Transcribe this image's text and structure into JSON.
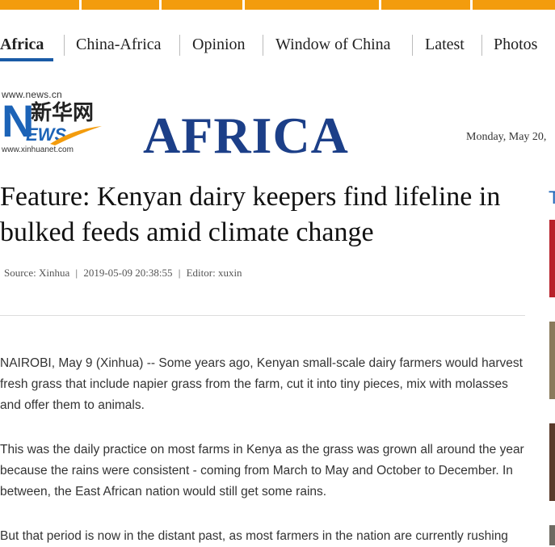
{
  "top_bar": {
    "color": "#f39c0d"
  },
  "nav": {
    "items": [
      {
        "label": "Africa",
        "active": true
      },
      {
        "label": "China-Africa"
      },
      {
        "label": "Opinion"
      },
      {
        "label": "Window of China"
      },
      {
        "label": "Latest"
      },
      {
        "label": "Photos"
      }
    ]
  },
  "logo": {
    "url_top": "www.news.cn",
    "cn_text": "新华网",
    "n_letter": "N",
    "ews": "EWS",
    "url_bottom": "www.xinhuanet.com"
  },
  "section_title": "AFRICA",
  "date": "Monday, May  20,",
  "article": {
    "headline": "Feature: Kenyan dairy keepers find lifeline in bulked feeds amid climate change",
    "source": "Source: Xinhua",
    "datetime": "2019-05-09 20:38:55",
    "editor": "Editor: xuxin",
    "meta_sep": "|",
    "paragraphs": [
      "NAIROBI, May 9 (Xinhua) -- Some years ago, Kenyan small-scale dairy farmers would harvest fresh grass that include napier grass from the farm, cut it into tiny pieces, mix with molasses and offer them to animals.",
      "This was the daily practice on most farms in Kenya as the grass was grown all around the year because the rains were consistent - coming from March to May and October to December. In between, the East African nation would still get some rains.",
      "But that period is now in the distant past, as most farmers in the nation are currently rushing"
    ]
  },
  "sidebar_glyph": "T"
}
